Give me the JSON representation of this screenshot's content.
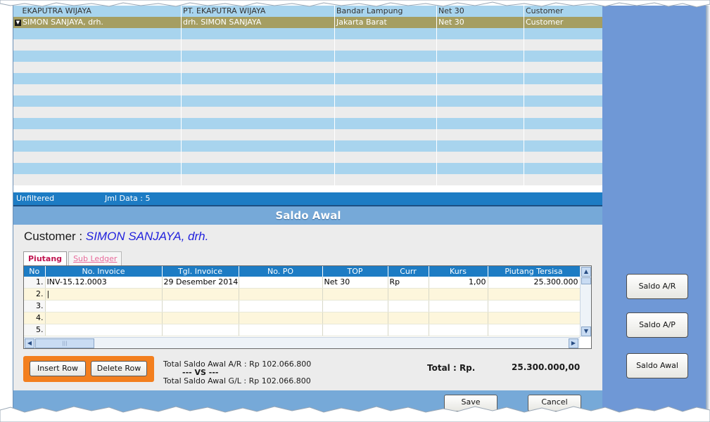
{
  "top_grid": {
    "rows": [
      {
        "name": "EKAPUTRA WIJAYA",
        "company": "PT. EKAPUTRA WIJAYA",
        "city": "Bandar Lampung",
        "terms": "Net 30",
        "type": "Customer"
      },
      {
        "name": "SIMON SANJAYA, drh.",
        "company": "drh. SIMON SANJAYA",
        "city": "Jakarta Barat",
        "terms": "Net 30",
        "type": "Customer"
      }
    ],
    "status_filter": "Unfiltered",
    "status_count": "Jml Data : 5"
  },
  "section": {
    "title": "Saldo Awal"
  },
  "customer": {
    "label": "Customer :",
    "name": "SIMON SANJAYA, drh."
  },
  "tabs": {
    "piutang": "Piutang",
    "sub_ledger": "Sub Ledger"
  },
  "invoice_grid": {
    "headers": [
      "No",
      "No. Invoice",
      "Tgl. Invoice",
      "No. PO",
      "TOP",
      "Curr",
      "Kurs",
      "Piutang Tersisa"
    ],
    "rows": [
      {
        "no": "1.",
        "invoice": "INV-15.12.0003",
        "date": "29 Desember 2014",
        "po": "",
        "top": "Net 30",
        "curr": "Rp",
        "kurs": "1,00",
        "remaining": "25.300.000"
      },
      {
        "no": "2.",
        "invoice": "|",
        "date": "",
        "po": "",
        "top": "",
        "curr": "",
        "kurs": "",
        "remaining": ""
      },
      {
        "no": "3.",
        "invoice": "",
        "date": "",
        "po": "",
        "top": "",
        "curr": "",
        "kurs": "",
        "remaining": ""
      },
      {
        "no": "4.",
        "invoice": "",
        "date": "",
        "po": "",
        "top": "",
        "curr": "",
        "kurs": "",
        "remaining": ""
      },
      {
        "no": "5.",
        "invoice": "",
        "date": "",
        "po": "",
        "top": "",
        "curr": "",
        "kurs": "",
        "remaining": ""
      }
    ]
  },
  "actions": {
    "insert_row": "Insert Row",
    "delete_row": "Delete Row",
    "save": "Save",
    "cancel": "Cancel"
  },
  "totals": {
    "ar": "Total Saldo Awal A/R : Rp 102.066.800",
    "vs": "--- VS ---",
    "gl": "Total Saldo Awal G/L : Rp 102.066.800",
    "total_label": "Total : Rp.",
    "total_value": "25.300.000,00"
  },
  "side_buttons": {
    "saldo_ar": "Saldo A/R",
    "saldo_ap": "Saldo A/P",
    "saldo_awal": "Saldo Awal"
  },
  "colors": {
    "header_blue": "#1d7cc4",
    "selected_row": "#a59e62",
    "panel_blue": "#6f98d6",
    "accent_orange": "#f37f1e",
    "customer_name": "#2222dd"
  },
  "icons": {
    "row_selector": "selected-row-arrow-icon",
    "scroll_up": "scroll-up-icon",
    "scroll_down": "scroll-down-icon",
    "scroll_left": "scroll-left-icon",
    "scroll_right": "scroll-right-icon"
  }
}
